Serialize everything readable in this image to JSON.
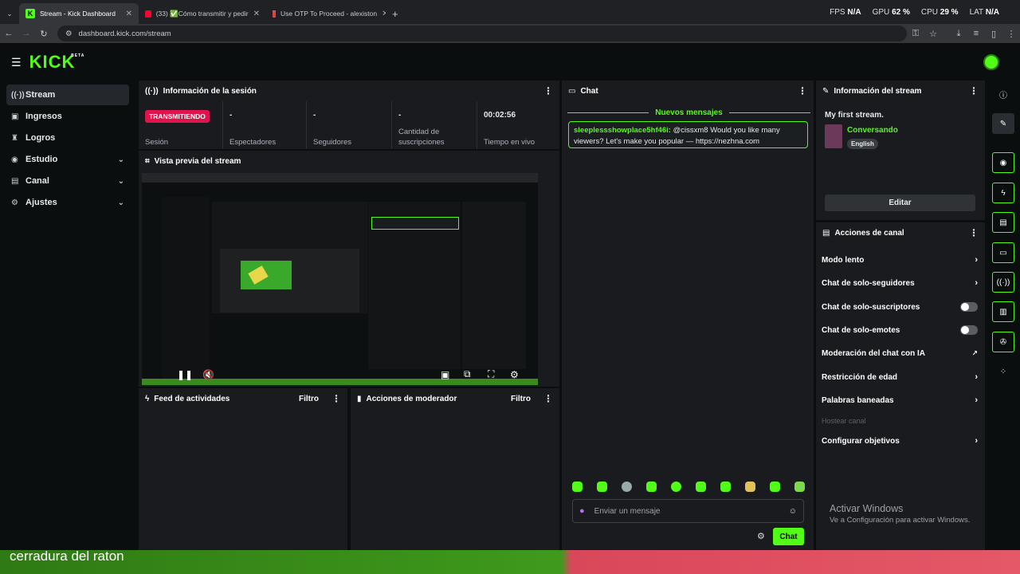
{
  "browser": {
    "tabs": [
      {
        "label": "Stream - Kick Dashboard",
        "active": true
      },
      {
        "label": "(33) ✅Cómo transmitir y pedir",
        "active": false
      },
      {
        "label": "Use OTP To Proceed - alexiston",
        "active": false
      }
    ],
    "url": "dashboard.kick.com/stream",
    "stats": {
      "fps_label": "FPS",
      "fps": "N/A",
      "gpu_label": "GPU",
      "gpu": "62 %",
      "cpu_label": "CPU",
      "cpu": "29 %",
      "lat_label": "LAT",
      "lat": "N/A"
    }
  },
  "header": {
    "logo": "KICK",
    "logo_tag": "BETA"
  },
  "sidebar": {
    "items": [
      {
        "label": "Stream",
        "icon": "broadcast-icon"
      },
      {
        "label": "Ingresos",
        "icon": "money-icon"
      },
      {
        "label": "Logros",
        "icon": "trophy-icon"
      },
      {
        "label": "Estudio",
        "icon": "studio-icon"
      },
      {
        "label": "Canal",
        "icon": "channel-icon"
      },
      {
        "label": "Ajustes",
        "icon": "gear-icon"
      }
    ]
  },
  "session": {
    "title": "Información de la sesión",
    "status_badge": "TRANSMITIENDO",
    "stats": [
      {
        "label": "Sesión",
        "value": ""
      },
      {
        "label": "Espectadores",
        "value": "-"
      },
      {
        "label": "Seguidores",
        "value": "-"
      },
      {
        "label": "Cantidad de suscripciones",
        "value": "-"
      },
      {
        "label": "Tiempo en vivo",
        "value": "00:02:56"
      }
    ]
  },
  "preview": {
    "title": "Vista previa del stream"
  },
  "activity": {
    "title": "Feed de actividades",
    "filter": "Filtro"
  },
  "moderator": {
    "title": "Acciones de moderador",
    "filter": "Filtro"
  },
  "chat": {
    "title": "Chat",
    "new_messages": "Nuevos mensajes",
    "message": {
      "user": "sleeplessshowplace5hf46i:",
      "text": " @cissxm8 Would you like many viewers? Let's make you popular — https://nezhna.com"
    },
    "input_placeholder": "Enviar un mensaje",
    "send_label": "Chat"
  },
  "stream_info": {
    "title": "Información del stream",
    "stream_title": "My first stream.",
    "category": "Conversando",
    "language": "English",
    "edit_label": "Editar"
  },
  "channel_actions": {
    "title": "Acciones de canal",
    "items": [
      {
        "label": "Modo lento",
        "control": "chevron"
      },
      {
        "label": "Chat de solo-seguidores",
        "control": "chevron"
      },
      {
        "label": "Chat de solo-suscriptores",
        "control": "toggle"
      },
      {
        "label": "Chat de solo-emotes",
        "control": "toggle"
      },
      {
        "label": "Moderación del chat con IA",
        "control": "external"
      },
      {
        "label": "Restricción de edad",
        "control": "chevron"
      },
      {
        "label": "Palabras baneadas",
        "control": "chevron"
      },
      {
        "label": "Hostear canal",
        "control": "none"
      },
      {
        "label": "Configurar objetivos",
        "control": "chevron"
      }
    ]
  },
  "windows_watermark": {
    "line1": "Activar Windows",
    "line2": "Ve a Configuración para activar Windows."
  },
  "caption": "cerradura del raton",
  "colors": {
    "accent": "#53fc18",
    "live": "#e0144c",
    "panel": "#191b1f",
    "bg": "#0b0e0f"
  }
}
